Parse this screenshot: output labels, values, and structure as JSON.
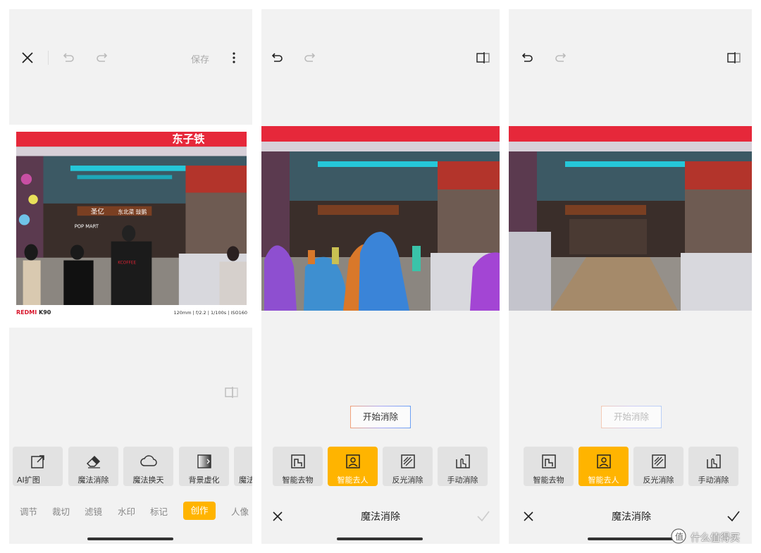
{
  "panel1": {
    "save_label": "保存",
    "footer_brand_red": "REDMI",
    "footer_brand_model": "K90",
    "footer_exif": "120mm | f/2.2 | 1/100s | ISO160",
    "tools": [
      {
        "label": "AI扩图",
        "icon": "expand-icon"
      },
      {
        "label": "魔法消除",
        "icon": "eraser-icon"
      },
      {
        "label": "魔法换天",
        "icon": "cloud-icon"
      },
      {
        "label": "背景虚化",
        "icon": "blur-icon"
      },
      {
        "label": "魔法",
        "icon": "partial-tool-icon"
      }
    ],
    "categories": [
      "调节",
      "裁切",
      "滤镜",
      "水印",
      "标记",
      "创作",
      "人像"
    ],
    "active_category": "创作"
  },
  "panel2": {
    "start_button": "开始消除",
    "tools": [
      {
        "label": "智能去物",
        "icon": "object-remove-icon"
      },
      {
        "label": "智能去人",
        "icon": "person-remove-icon"
      },
      {
        "label": "反光消除",
        "icon": "reflection-remove-icon"
      },
      {
        "label": "手动消除",
        "icon": "manual-remove-icon"
      }
    ],
    "active_tool": "智能去人",
    "title": "魔法消除"
  },
  "panel3": {
    "start_button": "开始消除",
    "tools": [
      {
        "label": "智能去物",
        "icon": "object-remove-icon"
      },
      {
        "label": "智能去人",
        "icon": "person-remove-icon"
      },
      {
        "label": "反光消除",
        "icon": "reflection-remove-icon"
      },
      {
        "label": "手动消除",
        "icon": "manual-remove-icon"
      }
    ],
    "active_tool": "智能去人",
    "title": "魔法消除"
  },
  "photo_signs": {
    "top_banner": "东子铁",
    "shop_name": "东北菜 豉鹅",
    "logo": "圣亿",
    "popmart": "POP MART",
    "jacket": "KCOFFEE"
  },
  "colors": {
    "accent": "#ffb400",
    "panel_bg": "#f2f2f2",
    "tool_bg": "#e2e2e2",
    "brand_red": "#d8142a"
  },
  "watermark": "什么值得买"
}
